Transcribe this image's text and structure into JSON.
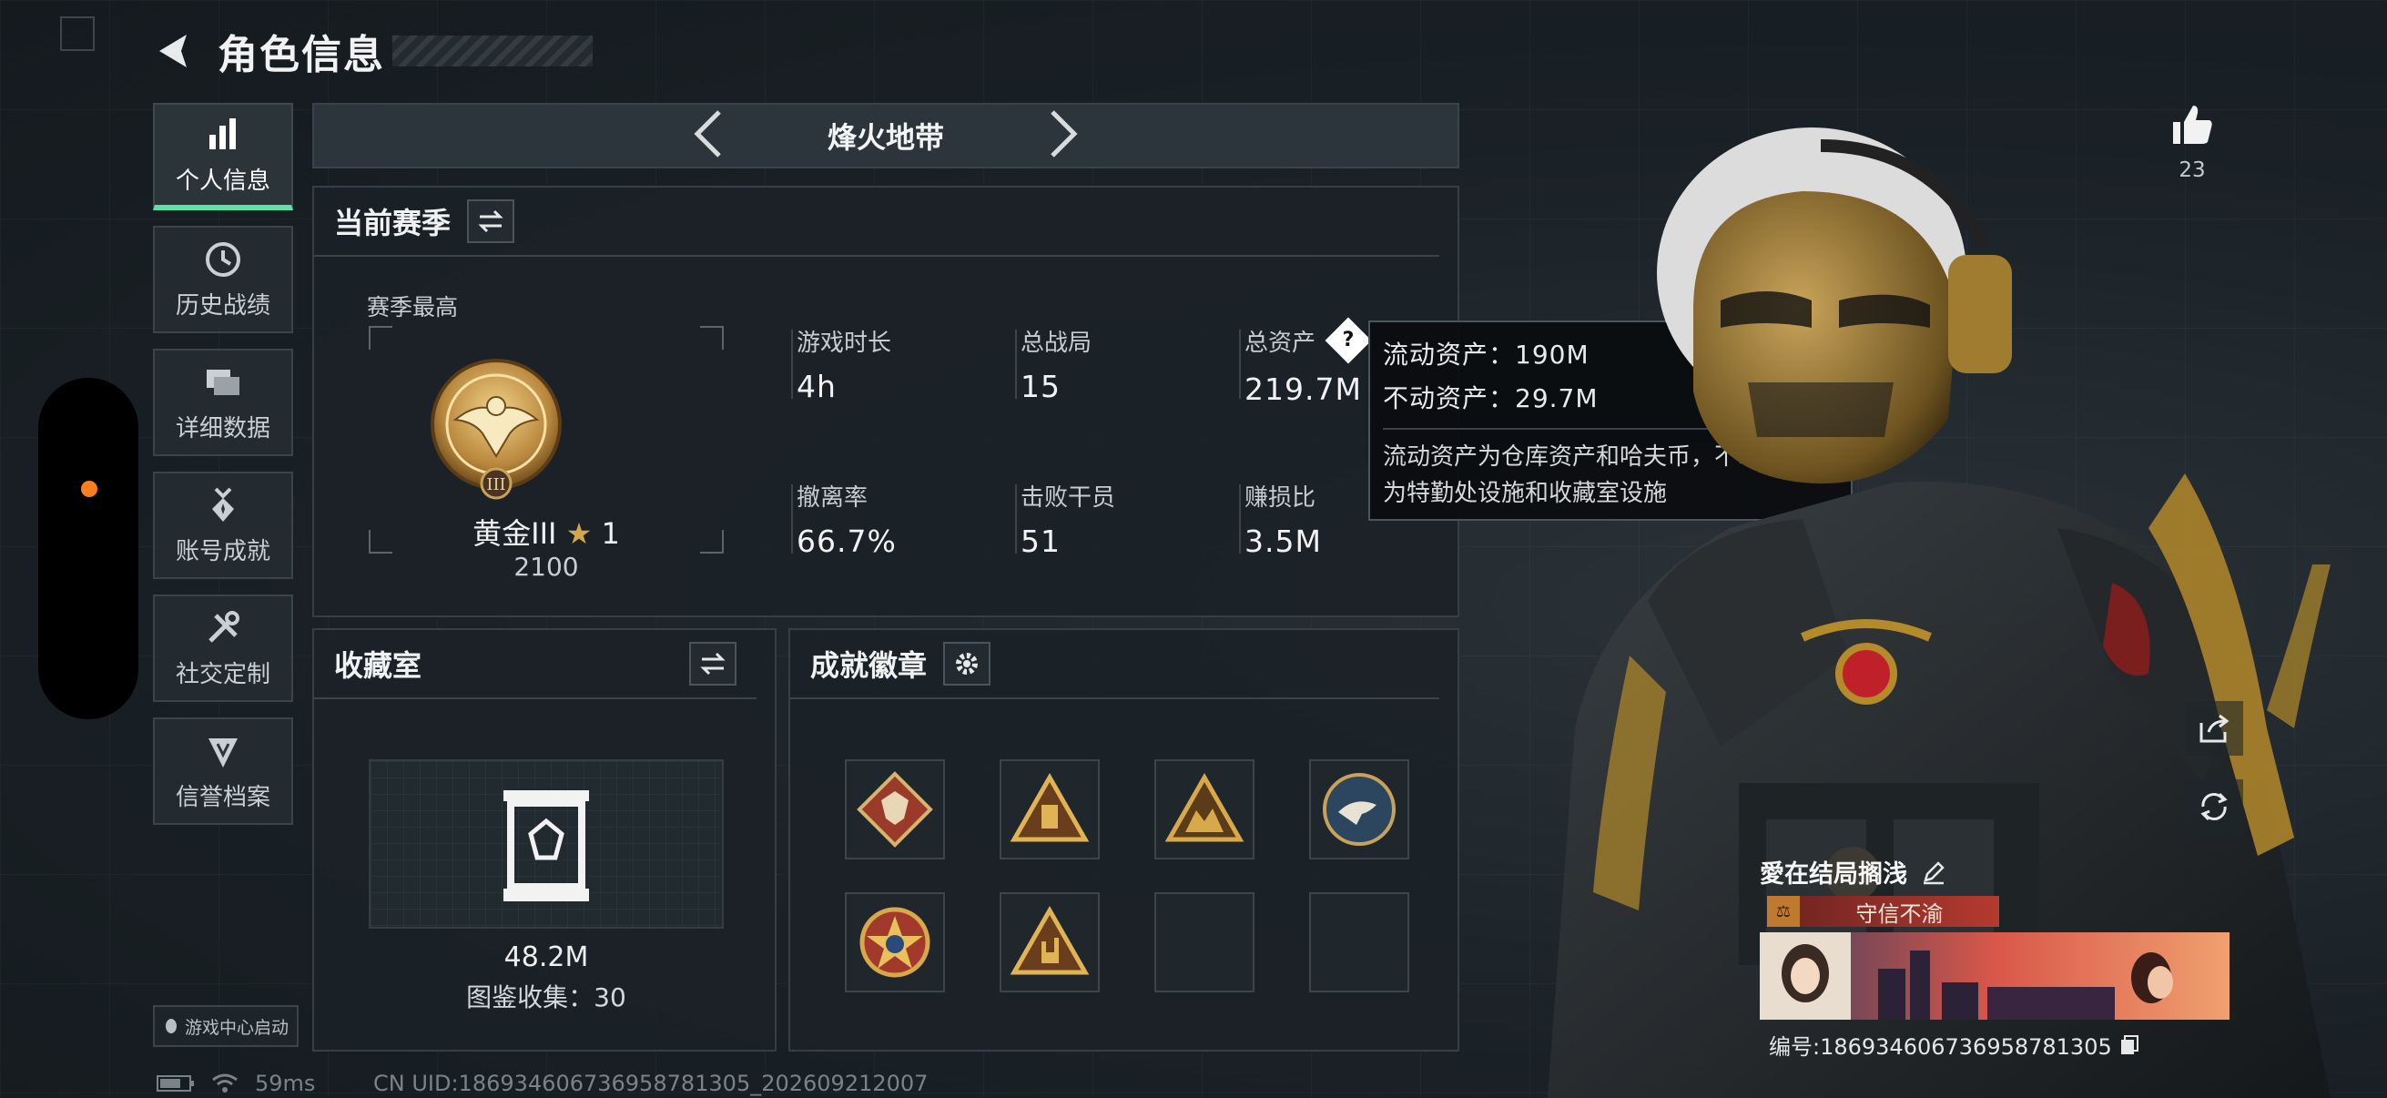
{
  "header": {
    "title": "角色信息"
  },
  "nav": {
    "items": [
      {
        "label": "个人信息",
        "icon": "bar-chart-icon",
        "active": true
      },
      {
        "label": "历史战绩",
        "icon": "history-icon"
      },
      {
        "label": "详细数据",
        "icon": "folders-icon"
      },
      {
        "label": "账号成就",
        "icon": "medal-icon"
      },
      {
        "label": "社交定制",
        "icon": "tools-icon"
      },
      {
        "label": "信誉档案",
        "icon": "shield-icon"
      }
    ],
    "game_center": "游戏中心启动"
  },
  "status": {
    "ping": "59ms",
    "uid": "CN UID:18693460673695878​1305_202609212007"
  },
  "mode": {
    "title": "烽火地带"
  },
  "season": {
    "title": "当前赛季",
    "subtitle": "赛季最高",
    "rank_name": "黄金III",
    "rank_stars": "1",
    "rank_score": "2100",
    "stats": [
      {
        "label": "游戏时长",
        "value": "4h"
      },
      {
        "label": "总战局",
        "value": "15"
      },
      {
        "label": "总资产",
        "value": "219.7M"
      },
      {
        "label": "撤离率",
        "value": "66.7%"
      },
      {
        "label": "击败干员",
        "value": "51"
      },
      {
        "label": "赚损比",
        "value": "3.5M"
      }
    ]
  },
  "tooltip": {
    "liquid": "流动资产：190M",
    "fixed": "不动资产：29.7M",
    "note_line1": "流动资产为仓库资产和哈夫币，不动资产",
    "note_line2": "为特勤处设施和收藏室设施"
  },
  "collection": {
    "title": "收藏室",
    "value": "48.2M",
    "count": "图鉴收集：30"
  },
  "badges": {
    "title": "成就徽章"
  },
  "social": {
    "likes": "23"
  },
  "player": {
    "name": "愛在结局搁浅",
    "title": "守信不渝",
    "uid": "编号:18693460673695878​1305"
  },
  "colors": {
    "accent": "#5fe0a6",
    "gold": "#d2a94a",
    "panel": "#1b2227",
    "dot": "#ff7f1e"
  }
}
